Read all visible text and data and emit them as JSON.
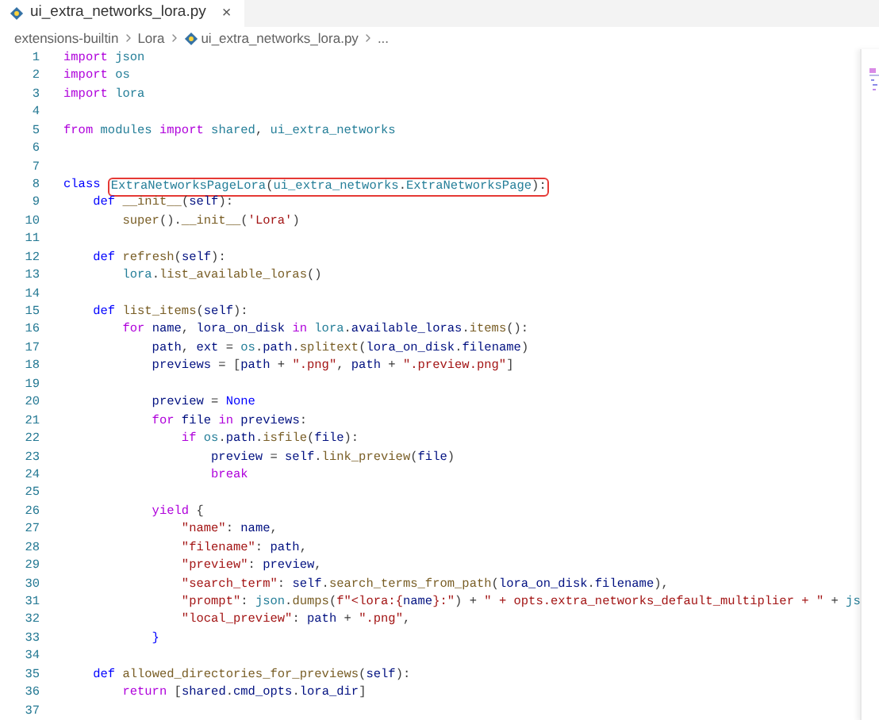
{
  "tab": {
    "title": "ui_extra_networks_lora.py",
    "close": "×"
  },
  "breadcrumb": {
    "items": [
      "extensions-builtin",
      "Lora",
      "ui_extra_networks_lora.py"
    ],
    "more": "..."
  },
  "lines": [
    {
      "number": "1",
      "tokens": [
        {
          "kind": "keyword",
          "t": "import "
        },
        {
          "kind": "module",
          "t": "json"
        }
      ]
    },
    {
      "number": "2",
      "tokens": [
        {
          "kind": "keyword",
          "t": "import "
        },
        {
          "kind": "module",
          "t": "os"
        }
      ]
    },
    {
      "number": "3",
      "tokens": [
        {
          "kind": "keyword",
          "t": "import "
        },
        {
          "kind": "module",
          "t": "lora"
        }
      ]
    },
    {
      "number": "4"
    },
    {
      "number": "5",
      "tokens": [
        {
          "kind": "keyword",
          "t": "from "
        },
        {
          "kind": "module",
          "t": "modules "
        },
        {
          "kind": "keyword",
          "t": "import "
        },
        {
          "kind": "module",
          "t": "shared"
        },
        {
          "kind": "plain",
          "t": ", "
        },
        {
          "kind": "module",
          "t": "ui_extra_networks"
        }
      ]
    },
    {
      "number": "6"
    },
    {
      "number": "7"
    },
    {
      "number": "8",
      "tokens": [
        {
          "kind": "declaration",
          "t": "class "
        },
        {
          "kind": "module",
          "t": "ExtraNetworksPageLora",
          "boxed": true
        },
        {
          "kind": "plain",
          "t": "(",
          "boxed": true
        },
        {
          "kind": "module",
          "t": "ui_extra_networks",
          "boxed": true
        },
        {
          "kind": "plain",
          "t": ".",
          "boxed": true
        },
        {
          "kind": "module",
          "t": "ExtraNetworksPage",
          "boxed": true
        },
        {
          "kind": "plain",
          "t": "):",
          "boxed": true
        }
      ]
    },
    {
      "number": "9",
      "tokens": [
        {
          "kind": "declaration",
          "t": "    def "
        },
        {
          "kind": "function",
          "t": "__init__"
        },
        {
          "kind": "plain",
          "t": "("
        },
        {
          "kind": "variable",
          "t": "self"
        },
        {
          "kind": "plain",
          "t": "):"
        }
      ]
    },
    {
      "number": "10",
      "tokens": [
        {
          "kind": "function",
          "t": "        super"
        },
        {
          "kind": "plain",
          "t": "()."
        },
        {
          "kind": "function",
          "t": "__init__"
        },
        {
          "kind": "plain",
          "t": "("
        },
        {
          "kind": "string",
          "t": "'Lora'"
        },
        {
          "kind": "plain",
          "t": ")"
        }
      ]
    },
    {
      "number": "11"
    },
    {
      "number": "12",
      "tokens": [
        {
          "kind": "declaration",
          "t": "    def "
        },
        {
          "kind": "function",
          "t": "refresh"
        },
        {
          "kind": "plain",
          "t": "("
        },
        {
          "kind": "variable",
          "t": "self"
        },
        {
          "kind": "plain",
          "t": "):"
        }
      ]
    },
    {
      "number": "13",
      "tokens": [
        {
          "kind": "module",
          "t": "        lora"
        },
        {
          "kind": "plain",
          "t": "."
        },
        {
          "kind": "function",
          "t": "list_available_loras"
        },
        {
          "kind": "plain",
          "t": "()"
        }
      ]
    },
    {
      "number": "14"
    },
    {
      "number": "15",
      "tokens": [
        {
          "kind": "declaration",
          "t": "    def "
        },
        {
          "kind": "function",
          "t": "list_items"
        },
        {
          "kind": "plain",
          "t": "("
        },
        {
          "kind": "variable",
          "t": "self"
        },
        {
          "kind": "plain",
          "t": "):"
        }
      ]
    },
    {
      "number": "16",
      "tokens": [
        {
          "kind": "keyword",
          "t": "        for "
        },
        {
          "kind": "variable",
          "t": "name"
        },
        {
          "kind": "plain",
          "t": ", "
        },
        {
          "kind": "variable",
          "t": "lora_on_disk "
        },
        {
          "kind": "keyword",
          "t": "in "
        },
        {
          "kind": "module",
          "t": "lora"
        },
        {
          "kind": "plain",
          "t": "."
        },
        {
          "kind": "variable",
          "t": "available_loras"
        },
        {
          "kind": "plain",
          "t": "."
        },
        {
          "kind": "function",
          "t": "items"
        },
        {
          "kind": "plain",
          "t": "():"
        }
      ]
    },
    {
      "number": "17",
      "tokens": [
        {
          "kind": "variable",
          "t": "            path"
        },
        {
          "kind": "plain",
          "t": ", "
        },
        {
          "kind": "variable",
          "t": "ext"
        },
        {
          "kind": "plain",
          "t": " = "
        },
        {
          "kind": "module",
          "t": "os"
        },
        {
          "kind": "plain",
          "t": "."
        },
        {
          "kind": "variable",
          "t": "path"
        },
        {
          "kind": "plain",
          "t": "."
        },
        {
          "kind": "function",
          "t": "splitext"
        },
        {
          "kind": "plain",
          "t": "("
        },
        {
          "kind": "variable",
          "t": "lora_on_disk"
        },
        {
          "kind": "plain",
          "t": "."
        },
        {
          "kind": "variable",
          "t": "filename"
        },
        {
          "kind": "plain",
          "t": ")"
        }
      ]
    },
    {
      "number": "18",
      "tokens": [
        {
          "kind": "variable",
          "t": "            previews"
        },
        {
          "kind": "plain",
          "t": " = ["
        },
        {
          "kind": "variable",
          "t": "path"
        },
        {
          "kind": "plain",
          "t": " + "
        },
        {
          "kind": "string",
          "t": "\".png\""
        },
        {
          "kind": "plain",
          "t": ", "
        },
        {
          "kind": "variable",
          "t": "path"
        },
        {
          "kind": "plain",
          "t": " + "
        },
        {
          "kind": "string",
          "t": "\".preview.png\""
        },
        {
          "kind": "plain",
          "t": "]"
        }
      ]
    },
    {
      "number": "19"
    },
    {
      "number": "20",
      "tokens": [
        {
          "kind": "variable",
          "t": "            preview"
        },
        {
          "kind": "plain",
          "t": " = "
        },
        {
          "kind": "declaration",
          "t": "None"
        }
      ]
    },
    {
      "number": "21",
      "tokens": [
        {
          "kind": "keyword",
          "t": "            for "
        },
        {
          "kind": "variable",
          "t": "file "
        },
        {
          "kind": "keyword",
          "t": "in "
        },
        {
          "kind": "variable",
          "t": "previews"
        },
        {
          "kind": "plain",
          "t": ":"
        }
      ]
    },
    {
      "number": "22",
      "tokens": [
        {
          "kind": "keyword",
          "t": "                if "
        },
        {
          "kind": "module",
          "t": "os"
        },
        {
          "kind": "plain",
          "t": "."
        },
        {
          "kind": "variable",
          "t": "path"
        },
        {
          "kind": "plain",
          "t": "."
        },
        {
          "kind": "function",
          "t": "isfile"
        },
        {
          "kind": "plain",
          "t": "("
        },
        {
          "kind": "variable",
          "t": "file"
        },
        {
          "kind": "plain",
          "t": "):"
        }
      ]
    },
    {
      "number": "23",
      "tokens": [
        {
          "kind": "variable",
          "t": "                    preview"
        },
        {
          "kind": "plain",
          "t": " = "
        },
        {
          "kind": "variable",
          "t": "self"
        },
        {
          "kind": "plain",
          "t": "."
        },
        {
          "kind": "function",
          "t": "link_preview"
        },
        {
          "kind": "plain",
          "t": "("
        },
        {
          "kind": "variable",
          "t": "file"
        },
        {
          "kind": "plain",
          "t": ")"
        }
      ]
    },
    {
      "number": "24",
      "tokens": [
        {
          "kind": "keyword",
          "t": "                    break"
        }
      ]
    },
    {
      "number": "25"
    },
    {
      "number": "26",
      "tokens": [
        {
          "kind": "keyword",
          "t": "            yield"
        },
        {
          "kind": "plain",
          "t": " {"
        }
      ]
    },
    {
      "number": "27",
      "tokens": [
        {
          "kind": "string",
          "t": "                \"name\""
        },
        {
          "kind": "plain",
          "t": ": "
        },
        {
          "kind": "variable",
          "t": "name"
        },
        {
          "kind": "plain",
          "t": ","
        }
      ]
    },
    {
      "number": "28",
      "tokens": [
        {
          "kind": "string",
          "t": "                \"filename\""
        },
        {
          "kind": "plain",
          "t": ": "
        },
        {
          "kind": "variable",
          "t": "path"
        },
        {
          "kind": "plain",
          "t": ","
        }
      ]
    },
    {
      "number": "29",
      "tokens": [
        {
          "kind": "string",
          "t": "                \"preview\""
        },
        {
          "kind": "plain",
          "t": ": "
        },
        {
          "kind": "variable",
          "t": "preview"
        },
        {
          "kind": "plain",
          "t": ","
        }
      ]
    },
    {
      "number": "30",
      "tokens": [
        {
          "kind": "string",
          "t": "                \"search_term\""
        },
        {
          "kind": "plain",
          "t": ": "
        },
        {
          "kind": "variable",
          "t": "self"
        },
        {
          "kind": "plain",
          "t": "."
        },
        {
          "kind": "function",
          "t": "search_terms_from_path"
        },
        {
          "kind": "plain",
          "t": "("
        },
        {
          "kind": "variable",
          "t": "lora_on_disk"
        },
        {
          "kind": "plain",
          "t": "."
        },
        {
          "kind": "variable",
          "t": "filename"
        },
        {
          "kind": "plain",
          "t": "),"
        }
      ]
    },
    {
      "number": "31",
      "tokens": [
        {
          "kind": "string",
          "t": "                \"prompt\""
        },
        {
          "kind": "plain",
          "t": ": "
        },
        {
          "kind": "module",
          "t": "json"
        },
        {
          "kind": "plain",
          "t": "."
        },
        {
          "kind": "function",
          "t": "dumps"
        },
        {
          "kind": "plain",
          "t": "("
        },
        {
          "kind": "string",
          "t": "f\"<lora:{"
        },
        {
          "kind": "variable",
          "t": "name"
        },
        {
          "kind": "string",
          "t": "}:\""
        },
        {
          "kind": "plain",
          "t": ") + "
        },
        {
          "kind": "string",
          "t": "\" + opts.extra_networks_default_multiplier + \""
        },
        {
          "kind": "plain",
          "t": " + "
        },
        {
          "kind": "module",
          "t": "js"
        }
      ]
    },
    {
      "number": "32",
      "tokens": [
        {
          "kind": "string",
          "t": "                \"local_preview\""
        },
        {
          "kind": "plain",
          "t": ": "
        },
        {
          "kind": "variable",
          "t": "path"
        },
        {
          "kind": "plain",
          "t": " + "
        },
        {
          "kind": "string",
          "t": "\".png\""
        },
        {
          "kind": "plain",
          "t": ","
        }
      ]
    },
    {
      "number": "33",
      "tokens": [
        {
          "kind": "declaration",
          "t": "            }"
        }
      ]
    },
    {
      "number": "34"
    },
    {
      "number": "35",
      "tokens": [
        {
          "kind": "declaration",
          "t": "    def "
        },
        {
          "kind": "function",
          "t": "allowed_directories_for_previews"
        },
        {
          "kind": "plain",
          "t": "("
        },
        {
          "kind": "variable",
          "t": "self"
        },
        {
          "kind": "plain",
          "t": "):"
        }
      ]
    },
    {
      "number": "36",
      "tokens": [
        {
          "kind": "keyword",
          "t": "        return"
        },
        {
          "kind": "plain",
          "t": " ["
        },
        {
          "kind": "variable",
          "t": "shared"
        },
        {
          "kind": "plain",
          "t": "."
        },
        {
          "kind": "variable",
          "t": "cmd_opts"
        },
        {
          "kind": "plain",
          "t": "."
        },
        {
          "kind": "variable",
          "t": "lora_dir"
        },
        {
          "kind": "plain",
          "t": "]"
        }
      ]
    },
    {
      "number": "37"
    }
  ]
}
